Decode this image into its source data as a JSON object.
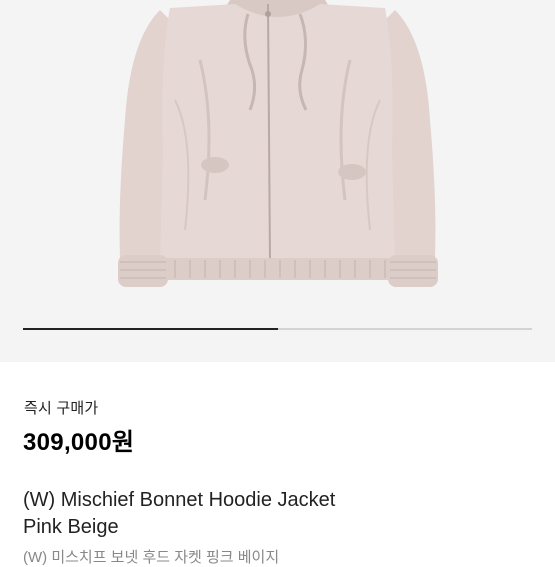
{
  "product": {
    "image_alt": "Pink beige hoodie jacket",
    "carousel_progress": 0.5,
    "price_label": "즉시 구매가",
    "price": "309,000원",
    "name_line1": "(W) Mischief Bonnet Hoodie Jacket",
    "name_line2": "Pink Beige",
    "name_ko": "(W) 미스치프 보넷 후드 자켓 핑크 베이지"
  },
  "colors": {
    "image_background": "#f4f4f4",
    "jacket": "#e3d4d0",
    "progress_active": "#222222",
    "progress_track": "#d3d3d3"
  }
}
